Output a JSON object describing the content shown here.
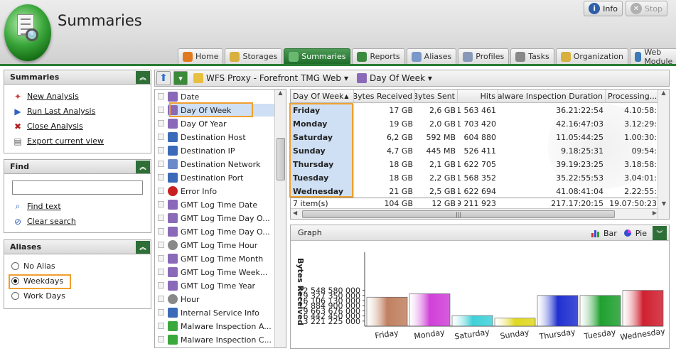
{
  "app": {
    "title": "Summaries"
  },
  "top_buttons": [
    {
      "label": "Info",
      "icon": "info-icon",
      "color": "#2f5fa8"
    },
    {
      "label": "Stop",
      "icon": "stop-icon",
      "color": "#b0b0b0"
    }
  ],
  "tabs": [
    {
      "label": "Home",
      "icon": "home-icon",
      "color": "#e07a20"
    },
    {
      "label": "Storages",
      "icon": "storage-icon",
      "color": "#d8b040"
    },
    {
      "label": "Summaries",
      "icon": "summaries-icon",
      "color": "#6ab870",
      "active": true
    },
    {
      "label": "Reports",
      "icon": "reports-icon",
      "color": "#3a8a40"
    },
    {
      "label": "Aliases",
      "icon": "aliases-icon",
      "color": "#7a98c8"
    },
    {
      "label": "Profiles",
      "icon": "profiles-icon",
      "color": "#8898b8"
    },
    {
      "label": "Tasks",
      "icon": "tasks-icon",
      "color": "#888888"
    },
    {
      "label": "Organization",
      "icon": "organization-icon",
      "color": "#d8b040"
    },
    {
      "label": "Web Module",
      "icon": "globe-icon",
      "color": "#3a7ab8"
    }
  ],
  "summaries_panel": {
    "title": "Summaries",
    "links": [
      {
        "label": "New Analysis",
        "icon": "new-analysis-icon"
      },
      {
        "label": "Run Last Analysis",
        "icon": "run-icon"
      },
      {
        "label": "Close Analysis",
        "icon": "close-icon"
      },
      {
        "label": "Export current view",
        "icon": "export-icon"
      }
    ]
  },
  "find_panel": {
    "title": "Find",
    "input_value": "",
    "links": [
      {
        "label": "Find text",
        "icon": "find-icon"
      },
      {
        "label": "Clear search",
        "icon": "clear-search-icon"
      }
    ]
  },
  "aliases_panel": {
    "title": "Aliases",
    "options": [
      {
        "label": "No Alias",
        "selected": false
      },
      {
        "label": "Weekdays",
        "selected": true
      },
      {
        "label": "Work Days",
        "selected": false
      }
    ]
  },
  "toolbar": {
    "source": "WFS Proxy - Forefront TMG Web",
    "view": "Day Of Week"
  },
  "tree_items": [
    {
      "label": "Date",
      "icon": "calendar-icon",
      "color": "#8a6ab8"
    },
    {
      "label": "Day Of Week",
      "icon": "calendar-icon",
      "color": "#8a6ab8",
      "selected": true
    },
    {
      "label": "Day Of Year",
      "icon": "calendar-icon",
      "color": "#8a6ab8"
    },
    {
      "label": "Destination Host",
      "icon": "host-icon",
      "color": "#3a6ab8"
    },
    {
      "label": "Destination IP",
      "icon": "ip-icon",
      "color": "#3a6ab8"
    },
    {
      "label": "Destination Network",
      "icon": "network-icon",
      "color": "#6a8ac8"
    },
    {
      "label": "Destination Port",
      "icon": "port-icon",
      "color": "#3a6ab8"
    },
    {
      "label": "Error Info",
      "icon": "error-icon",
      "color": "#c82020"
    },
    {
      "label": "GMT Log Time Date",
      "icon": "calendar-icon",
      "color": "#8a6ab8"
    },
    {
      "label": "GMT Log Time Day O...",
      "icon": "calendar-icon",
      "color": "#8a6ab8"
    },
    {
      "label": "GMT Log Time Day O...",
      "icon": "calendar-icon",
      "color": "#8a6ab8"
    },
    {
      "label": "GMT Log Time Hour",
      "icon": "clock-icon",
      "color": "#888888"
    },
    {
      "label": "GMT Log Time Month",
      "icon": "calendar-icon",
      "color": "#8a6ab8"
    },
    {
      "label": "GMT Log Time Week...",
      "icon": "calendar-icon",
      "color": "#8a6ab8"
    },
    {
      "label": "GMT Log Time Year",
      "icon": "calendar-icon",
      "color": "#8a6ab8"
    },
    {
      "label": "Hour",
      "icon": "clock-icon",
      "color": "#888888"
    },
    {
      "label": "Internal Service Info",
      "icon": "service-icon",
      "color": "#3a6ab8"
    },
    {
      "label": "Malware Inspection A...",
      "icon": "shield-icon",
      "color": "#3aa83a"
    },
    {
      "label": "Malware Inspection C...",
      "icon": "shield-icon",
      "color": "#3aa83a"
    }
  ],
  "grid": {
    "columns": [
      "Day Of Week",
      "Bytes Received",
      "Bytes Sent",
      "Hits",
      "Malware Inspection Duration",
      "Processing..."
    ],
    "sort_indicator": "▲",
    "rows": [
      [
        "Friday",
        "17 GB",
        "2,6 GB",
        "1 563 461",
        "36.21:22:54",
        "4.10:58:"
      ],
      [
        "Monday",
        "19 GB",
        "2,0 GB",
        "1 703 420",
        "42.16:47:03",
        "3.12:29:"
      ],
      [
        "Saturday",
        "6,2 GB",
        "592 MB",
        "604 880",
        "11.05:44:25",
        "1.00:30:"
      ],
      [
        "Sunday",
        "4,7 GB",
        "445 MB",
        "526 411",
        "9.18:25:31",
        "09:54:"
      ],
      [
        "Thursday",
        "18 GB",
        "2,1 GB",
        "1 622 705",
        "39.19:23:25",
        "3.18:58:"
      ],
      [
        "Tuesday",
        "18 GB",
        "2,2 GB",
        "1 568 352",
        "35.22:55:53",
        "3.04:01:"
      ],
      [
        "Wednesday",
        "21 GB",
        "2,5 GB",
        "1 622 694",
        "41.08:41:04",
        "2.22:55:"
      ]
    ],
    "footer": [
      "7 item(s)",
      "104 GB",
      "12 GB",
      "9 211 923",
      "217.17:20:15",
      "19.07:50:23"
    ]
  },
  "graph": {
    "title": "Graph",
    "bar_label": "Bar",
    "pie_label": "Pie"
  },
  "chart_data": {
    "type": "bar",
    "ylabel": "Bytes Received",
    "categories": [
      "Friday",
      "Monday",
      "Saturday",
      "Sunday",
      "Thursday",
      "Tuesday",
      "Wednesday"
    ],
    "values": [
      17,
      19,
      6.2,
      4.7,
      18,
      18,
      21
    ],
    "value_unit": "GB",
    "yticks": [
      "3 221 225 000",
      "6 442 450 000",
      "9 663 676 000",
      "12 884 900 000",
      "16 106 130 000",
      "19 327 350 000",
      "22 548 580 000"
    ],
    "colors": [
      "#c08060",
      "#d040d8",
      "#40d0d8",
      "#e0d820",
      "#2030d0",
      "#20a030",
      "#d02030"
    ]
  }
}
